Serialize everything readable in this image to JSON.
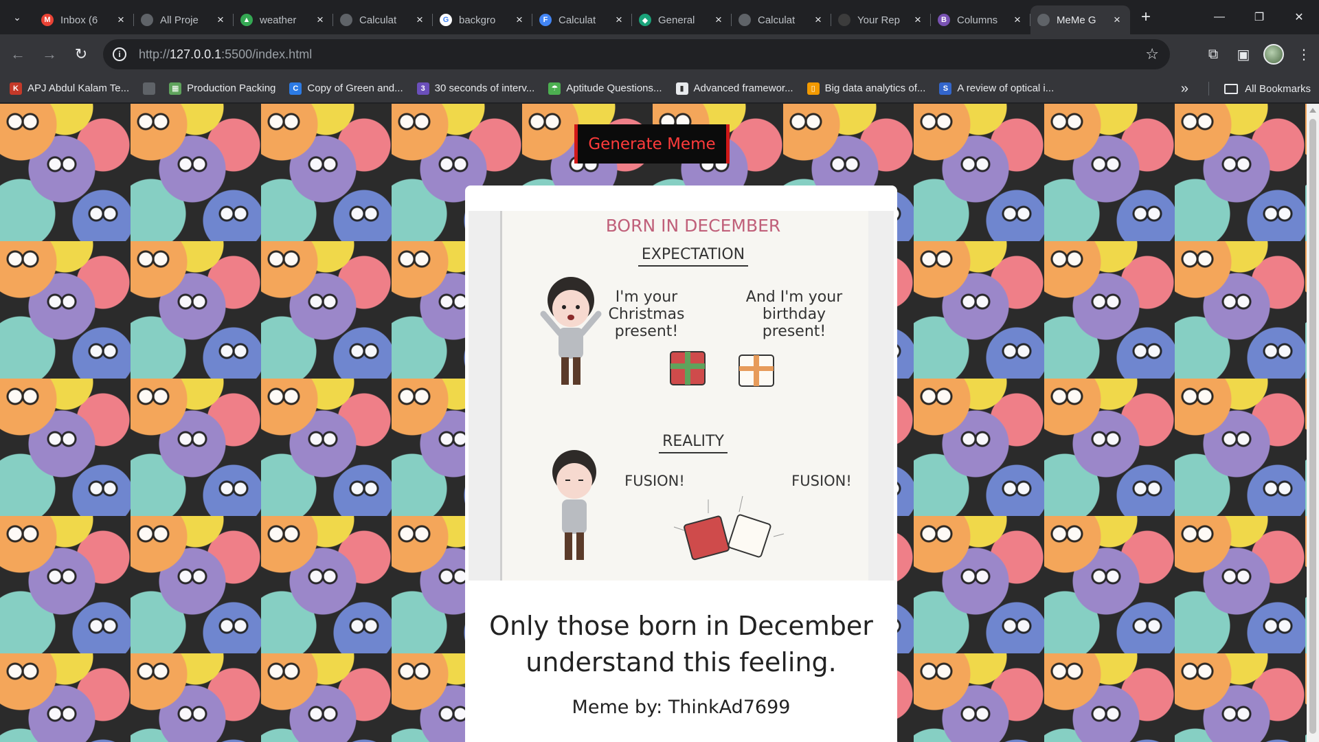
{
  "browser": {
    "tabs": [
      {
        "title": "Inbox (6",
        "icon": "gmail-icon",
        "color": "#ea4335",
        "glyph": "M"
      },
      {
        "title": "All Proje",
        "icon": "globe-icon",
        "color": "#5f6368",
        "glyph": ""
      },
      {
        "title": "weather",
        "icon": "drive-icon",
        "color": "#34a853",
        "glyph": "▲"
      },
      {
        "title": "Calculat",
        "icon": "globe-icon",
        "color": "#5f6368",
        "glyph": ""
      },
      {
        "title": "backgro",
        "icon": "google-icon",
        "color": "#ffffff",
        "glyph": "G"
      },
      {
        "title": "Calculat",
        "icon": "forms-icon",
        "color": "#4285f4",
        "glyph": "F"
      },
      {
        "title": "General",
        "icon": "diamond-icon",
        "color": "#1aa37a",
        "glyph": "◆"
      },
      {
        "title": "Calculat",
        "icon": "globe-icon",
        "color": "#5f6368",
        "glyph": ""
      },
      {
        "title": "Your Rep",
        "icon": "github-icon",
        "color": "#3c3c3c",
        "glyph": ""
      },
      {
        "title": "Columns",
        "icon": "bootstrap-icon",
        "color": "#7952b3",
        "glyph": "B"
      },
      {
        "title": "MeMe G",
        "icon": "globe-icon",
        "color": "#5f6368",
        "glyph": "",
        "active": true
      }
    ],
    "url_prefix": "http://",
    "url_host": "127.0.0.1",
    "url_rest": ":5500/index.html",
    "bookmarks": [
      {
        "label": "APJ Abdul Kalam Te...",
        "icon": "ktu-icon",
        "color": "#c53929",
        "glyph": "K"
      },
      {
        "label": "",
        "icon": "globe-icon",
        "color": "#5f6368",
        "glyph": ""
      },
      {
        "label": "Production Packing",
        "icon": "sheet-icon",
        "color": "#5fa35c",
        "glyph": "▦"
      },
      {
        "label": "Copy of Green and...",
        "icon": "canva-icon",
        "color": "#2c7be5",
        "glyph": "C"
      },
      {
        "label": "30 seconds of interv...",
        "icon": "code-icon",
        "color": "#6b4fbb",
        "glyph": "3"
      },
      {
        "label": "Aptitude Questions...",
        "icon": "indiabix-icon",
        "color": "#4caf50",
        "glyph": "☂"
      },
      {
        "label": "Advanced framewor...",
        "icon": "ieee-icon",
        "color": "#e8eaed",
        "glyph": "▮"
      },
      {
        "label": "Big data analytics of...",
        "icon": "book-icon",
        "color": "#f29900",
        "glyph": "▯"
      },
      {
        "label": "A review of optical i...",
        "icon": "ssrn-icon",
        "color": "#3366cc",
        "glyph": "S"
      }
    ],
    "all_bookmarks": "All Bookmarks"
  },
  "page": {
    "generate_button": "Generate Meme",
    "caption_line1": "Only those born in December",
    "caption_line2": "understand this feeling.",
    "author": "Meme by: ThinkAd7699"
  },
  "meme_image": {
    "heading": "BORN IN DECEMBER",
    "expectation": "EXPECTATION",
    "bubble1": [
      "I'm your",
      "Christmas",
      "present!"
    ],
    "bubble2": [
      "And I'm your",
      "birthday",
      "present!"
    ],
    "reality": "REALITY",
    "fusion": "FUSION!"
  },
  "colors": {
    "button_text": "#ff3b3b",
    "button_border": "#d01818",
    "heading_pink": "#c0607a"
  }
}
